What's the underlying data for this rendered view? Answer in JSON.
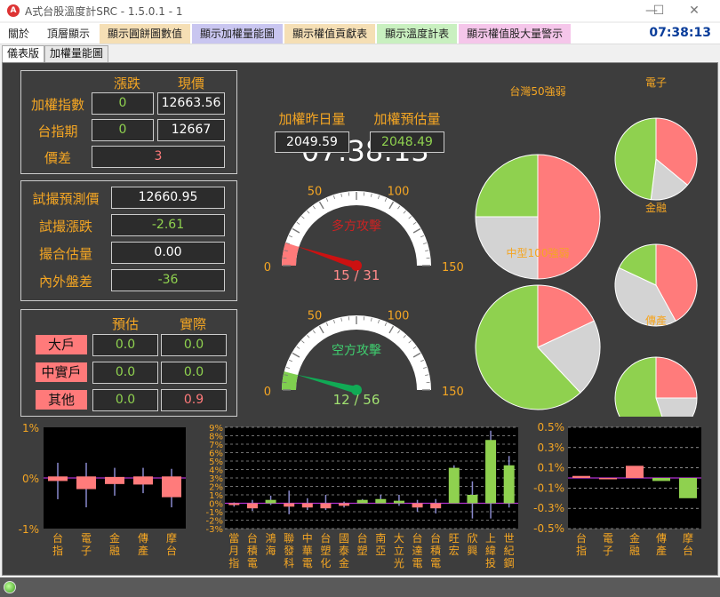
{
  "window": {
    "title": "A式台股溫度計SRC - 1.5.0.1 - 1",
    "min": "—",
    "max": "☐",
    "close": "✕"
  },
  "menu": [
    {
      "label": "關於",
      "color": "#ffffff"
    },
    {
      "label": "頂層顯示",
      "color": "#ffffff"
    },
    {
      "label": "顯示圓餅圖數值",
      "color": "#f5dfb5"
    },
    {
      "label": "顯示加權量能圖",
      "color": "#c9c6f0"
    },
    {
      "label": "顯示權值貢獻表",
      "color": "#f5dfb5"
    },
    {
      "label": "顯示溫度計表",
      "color": "#c9f0c0"
    },
    {
      "label": "顯示權值股大量警示",
      "color": "#f5c6ea"
    }
  ],
  "clock": "07:38:13",
  "tabs": [
    "儀表版",
    "加權量能圖"
  ],
  "index_box": {
    "headers": [
      "漲跌",
      "現價"
    ],
    "rows": [
      {
        "label": "加權指數",
        "change": "0",
        "price": "12663.56"
      },
      {
        "label": "台指期",
        "change": "0",
        "price": "12667"
      }
    ],
    "spread_label": "價差",
    "spread": "3"
  },
  "trial_box": {
    "rows": [
      {
        "label": "試撮預測價",
        "value": "12660.95"
      },
      {
        "label": "試撮漲跌",
        "value": "-2.61"
      },
      {
        "label": "撮合估量",
        "value": "0.00"
      },
      {
        "label": "內外盤差",
        "value": "-36"
      }
    ]
  },
  "est_box": {
    "headers": [
      "預估",
      "實際"
    ],
    "rows": [
      {
        "label": "大戶",
        "est": "0.0",
        "actual": "0.0"
      },
      {
        "label": "中實戶",
        "est": "0.0",
        "actual": "0.0"
      },
      {
        "label": "其他",
        "est": "0.0",
        "actual": "0.9"
      }
    ]
  },
  "big_clock": "07:38:13",
  "volume": {
    "yesterday_label": "加權昨日量",
    "yesterday": "2049.59",
    "estimate_label": "加權預估量",
    "estimate": "2048.49"
  },
  "gauges": [
    {
      "title": "多方攻擊",
      "value": 15,
      "max": 31,
      "display": "15 / 31",
      "ticks": [
        "0",
        "50",
        "100",
        "150"
      ],
      "color": "#ff7a7a",
      "needle": "#cc1111",
      "text_color": "#ff8a8a"
    },
    {
      "title": "空方攻擊",
      "value": 12,
      "max": 56,
      "display": "12 / 56",
      "ticks": [
        "0",
        "50",
        "100",
        "150"
      ],
      "color": "#7fcf4f",
      "needle": "#11aa55",
      "text_color": "#a0e070"
    }
  ],
  "pies": [
    {
      "title": "台灣50強弱",
      "up": 0.5,
      "flat": 0.25,
      "down": 0.25
    },
    {
      "title": "中型100強弱",
      "up": 0.18,
      "flat": 0.2,
      "down": 0.62
    },
    {
      "title": "電子",
      "up": 0.36,
      "flat": 0.16,
      "down": 0.48
    },
    {
      "title": "金融",
      "up": 0.42,
      "flat": 0.4,
      "down": 0.18
    },
    {
      "title": "傳產",
      "up": 0.25,
      "flat": 0.2,
      "down": 0.55
    }
  ],
  "colors": {
    "up": "#ff7b7b",
    "flat": "#d3d3d3",
    "down": "#8fd14f",
    "accent": "#f5a623",
    "bg": "#3d3d3d"
  },
  "chart_data": [
    {
      "type": "candlestick",
      "yticks": [
        "1%",
        "0%",
        "-1%"
      ],
      "ylim": [
        -1,
        1
      ],
      "categories": [
        "台指",
        "電子",
        "金融",
        "傳產",
        "摩台"
      ],
      "open": [
        0.03,
        0.03,
        0.02,
        0.03,
        0.03
      ],
      "close": [
        -0.06,
        -0.22,
        -0.12,
        -0.13,
        -0.38
      ],
      "high": [
        0.3,
        0.3,
        0.2,
        0.2,
        0.18
      ],
      "low": [
        -0.42,
        -0.58,
        -0.35,
        -0.3,
        -0.58
      ]
    },
    {
      "type": "candlestick",
      "yticks": [
        "9%",
        "8%",
        "7%",
        "6%",
        "5%",
        "4%",
        "3%",
        "2%",
        "1%",
        "0%",
        "-1%",
        "-2%",
        "-3%"
      ],
      "ylim": [
        -3,
        9
      ],
      "categories": [
        "當月指",
        "台積電",
        "鴻海",
        "聯發科",
        "中華電",
        "台塑化",
        "國泰金",
        "台塑",
        "南亞",
        "大立光",
        "台達電",
        "台積電",
        "旺宏",
        "欣興",
        "上緯投",
        "世紀鋼"
      ],
      "open": [
        0,
        0,
        0,
        0,
        0,
        0,
        0,
        0,
        0,
        0,
        0,
        0,
        0,
        0,
        0,
        0
      ],
      "close": [
        -0.2,
        -0.6,
        0.4,
        -0.4,
        -0.5,
        -0.6,
        -0.3,
        0.4,
        0.5,
        0.3,
        -0.5,
        -0.6,
        4.2,
        1.0,
        7.5,
        4.5
      ],
      "high": [
        0.1,
        0.4,
        0.9,
        1.5,
        0.6,
        1.0,
        0.2,
        0.5,
        1.0,
        1.0,
        0.4,
        0.5,
        4.5,
        2.6,
        8.6,
        5.6
      ],
      "low": [
        -0.4,
        -0.9,
        -0.2,
        -1.3,
        -0.8,
        -0.8,
        -0.5,
        0.1,
        0.4,
        -0.3,
        -1.0,
        -1.2,
        0,
        -1.8,
        -1.8,
        -0.5
      ]
    },
    {
      "type": "bar",
      "yticks": [
        "0.5%",
        "0.3%",
        "0.1%",
        "-0.1%",
        "-0.3%",
        "-0.5%"
      ],
      "ylim": [
        -0.5,
        0.5
      ],
      "categories": [
        "台指",
        "電子",
        "金融",
        "傳產",
        "摩台"
      ],
      "values": [
        0.02,
        0.0,
        0.12,
        -0.03,
        -0.2
      ]
    }
  ]
}
